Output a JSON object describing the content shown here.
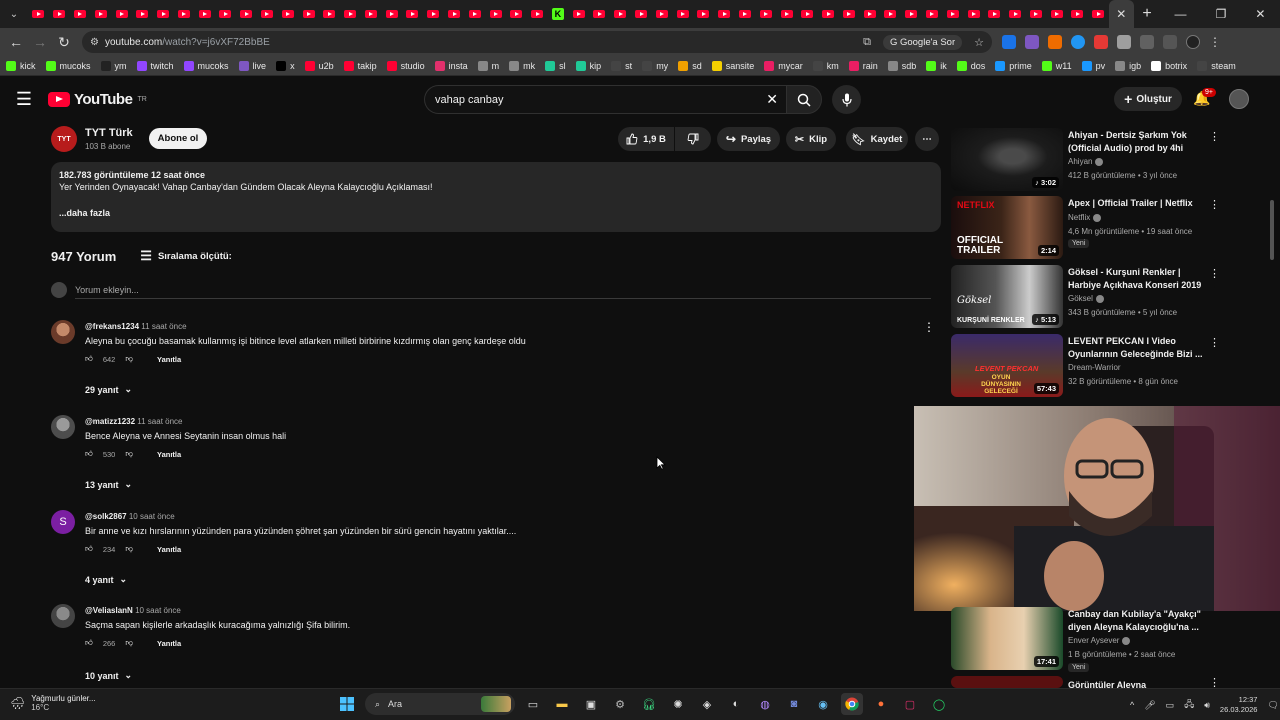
{
  "browser": {
    "url_host": "youtube.com",
    "url_path": "/watch?v=j6vXF72BbBE",
    "google_ask": "Google'a Sor",
    "bookmarks": [
      "kick",
      "mucoks",
      "ym",
      "twitch",
      "mucoks",
      "live",
      "x",
      "u2b",
      "takip",
      "studio",
      "insta",
      "m",
      "mk",
      "sl",
      "kip",
      "st",
      "my",
      "sd",
      "sansite",
      "mycar",
      "km",
      "rain",
      "sdb",
      "ik",
      "dos",
      "prime",
      "w11",
      "pv",
      "igb",
      "botrix",
      "steam"
    ]
  },
  "header": {
    "logo_text": "YouTube",
    "logo_country": "TR",
    "search_value": "vahap canbay",
    "create_label": "Oluştur",
    "notif_badge": "9+"
  },
  "video": {
    "channel_name": "TYT Türk",
    "channel_subs": "103 B abone",
    "channel_logo": "TYT",
    "subscribe_label": "Abone ol",
    "likes": "1,9 B",
    "share_label": "Paylaş",
    "clip_label": "Klip",
    "save_label": "Kaydet",
    "desc_meta": "182.783 görüntüleme  12 saat önce",
    "desc_text": "Yer Yerinden Oynayacak! Vahap Canbay'dan Gündem Olacak Aleyna Kalaycıoğlu Açıklaması!",
    "desc_more": "...daha fazla"
  },
  "comments": {
    "count": "947 Yorum",
    "sort_label": "Sıralama ölçütü:",
    "add_placeholder": "Yorum ekleyin...",
    "reply_label": "Yanıtla",
    "items": [
      {
        "user": "@frekans1234",
        "time": "11 saat önce",
        "text": "Aleyna bu çocuğu basamak kullanmış işi bitince level atlarken milleti birbirine kızdırmış olan genç kardeşe oldu",
        "likes": "642",
        "replies": "29 yanıt"
      },
      {
        "user": "@matizz1232",
        "time": "11 saat önce",
        "text": "Bence Aleyna ve Annesi Seytanin insan olmus hali",
        "likes": "530",
        "replies": "13 yanıt"
      },
      {
        "user": "@solk2867",
        "time": "10 saat önce",
        "text": "Bir anne ve kızı hırslarının yüzünden para yüzünden şöhret şan yüzünden bir sürü gencin hayatını yaktılar....",
        "likes": "234",
        "replies": "4 yanıt",
        "avatar_letter": "S"
      },
      {
        "user": "@VeliaslanN",
        "time": "10 saat önce",
        "text": "Saçma sapan kişilerle arkadaşlık kuracağıma yalnızlığı Şifa bilirim.",
        "likes": "266",
        "replies": "10 yanıt"
      }
    ]
  },
  "sidebar": [
    {
      "title": "Ahiyan - Dertsiz Şarkım Yok (Official Audio) prod by 4hi",
      "channel": "Ahiyan",
      "meta": "412 B görüntüleme • 3 yıl önce",
      "duration": "3:02"
    },
    {
      "title": "Apex | Official Trailer | Netflix",
      "channel": "Netflix",
      "meta": "4,6 Mn görüntüleme • 19 saat önce",
      "duration": "2:14",
      "new": "Yeni",
      "thumb_top": "NETFLIX",
      "thumb_text": "OFFICIAL TRAILER"
    },
    {
      "title": "Göksel - Kurşuni Renkler | Harbiye Açıkhava Konseri 2019",
      "channel": "Göksel",
      "meta": "343 B görüntüleme • 5 yıl önce",
      "duration": "5:13",
      "thumb_text": "KURŞUNİ RENKLER",
      "thumb_sign": "Göksel"
    },
    {
      "title": "LEVENT PEKCAN I Video Oyunlarının Geleceğinde Bizi ...",
      "channel": "Dream-Warrior",
      "meta": "32 B görüntüleme • 8 gün önce",
      "duration": "57:43",
      "thumb_text": "LEVENT PEKCAN",
      "thumb_text2": "OYUN DÜNYASININ GELECEĞİ"
    },
    {
      "title": "Canbay dan Kubilay'a \"Ayakçı\" diyen Aleyna Kalaycıoğlu'na ...",
      "channel": "Enver Aysever",
      "meta": "1 B görüntüleme • 2 saat önce",
      "duration": "17:41",
      "new": "Yeni"
    },
    {
      "title": "Görüntüler Aleyna",
      "channel": "",
      "meta": "",
      "duration": ""
    }
  ],
  "taskbar": {
    "weather_text": "Yağmurlu günler...",
    "temp": "16°C",
    "search_label": "Ara",
    "time": "12:37",
    "date": "26.03.2026"
  }
}
